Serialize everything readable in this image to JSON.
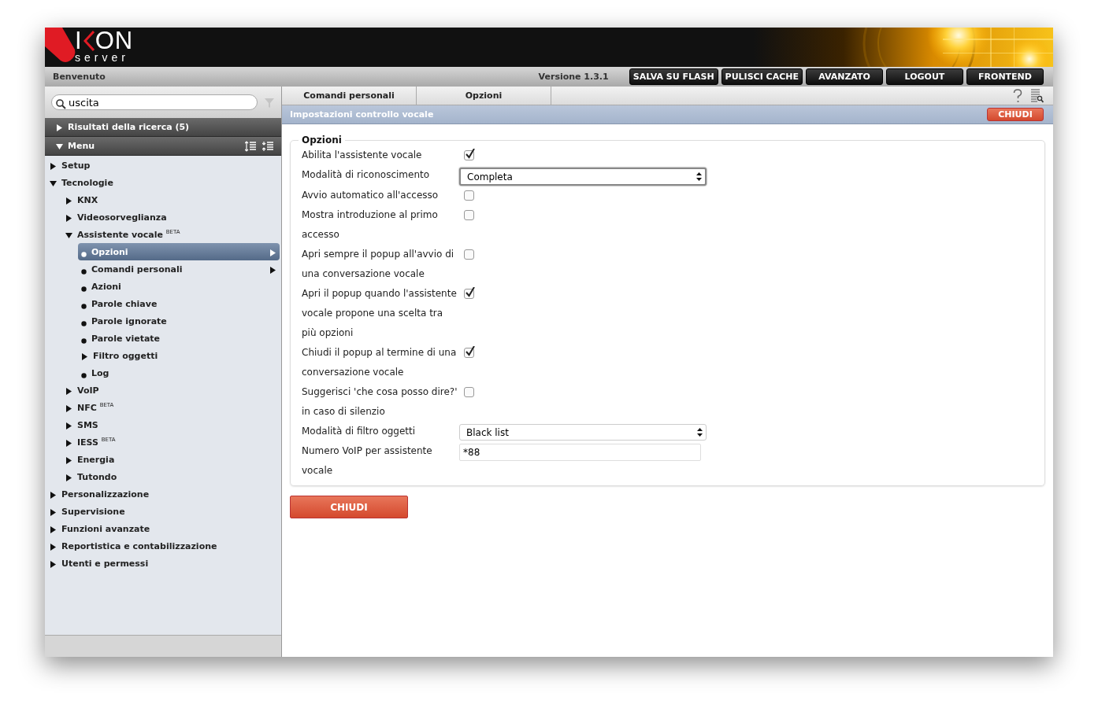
{
  "header": {
    "logo": {
      "lead": "I",
      "tail": "ON",
      "subtitle": "server"
    }
  },
  "topbar": {
    "welcome": "Benvenuto",
    "version": "Versione 1.3.1",
    "buttons": [
      "SALVA SU FLASH",
      "PULISCI CACHE",
      "AVANZATO",
      "LOGOUT",
      "FRONTEND"
    ]
  },
  "sidebar": {
    "search": {
      "value": "uscita"
    },
    "results": {
      "label": "Risultati della ricerca (5)",
      "expanded": false
    },
    "menu": {
      "label": "Menu",
      "expanded": true,
      "items": [
        {
          "label": "Setup",
          "kind": "branch",
          "expanded": false,
          "selected": false
        },
        {
          "label": "Tecnologie",
          "kind": "branch",
          "expanded": true,
          "selected": false,
          "children": [
            {
              "label": "KNX",
              "kind": "branch",
              "expanded": false,
              "selected": false
            },
            {
              "label": "Videosorveglianza",
              "kind": "branch",
              "expanded": false,
              "selected": false
            },
            {
              "label": "Assistente vocale $^{BETA}$",
              "kind": "branch",
              "expanded": true,
              "selected": false,
              "children": [
                {
                  "label": "Opzioni",
                  "kind": "leaf",
                  "selected": true,
                  "submenu": true
                },
                {
                  "label": "Comandi personali",
                  "kind": "leaf",
                  "selected": false,
                  "submenu": true
                },
                {
                  "label": "Azioni",
                  "kind": "leaf",
                  "selected": false,
                  "submenu": false
                },
                {
                  "label": "Parole chiave",
                  "kind": "leaf",
                  "selected": false,
                  "submenu": false
                },
                {
                  "label": "Parole ignorate",
                  "kind": "leaf",
                  "selected": false,
                  "submenu": false
                },
                {
                  "label": "Parole vietate",
                  "kind": "leaf",
                  "selected": false,
                  "submenu": false
                },
                {
                  "label": "Filtro oggetti",
                  "kind": "branch",
                  "expanded": false,
                  "selected": false
                },
                {
                  "label": "Log",
                  "kind": "leaf",
                  "selected": false,
                  "submenu": false
                }
              ]
            },
            {
              "label": "VoIP",
              "kind": "branch",
              "expanded": false,
              "selected": false
            },
            {
              "label": "NFC $^{BETA}$",
              "kind": "branch",
              "expanded": false,
              "selected": false
            },
            {
              "label": "SMS",
              "kind": "branch",
              "expanded": false,
              "selected": false
            },
            {
              "label": "IESS $^{BETA}$",
              "kind": "branch",
              "expanded": false,
              "selected": false
            },
            {
              "label": "Energia",
              "kind": "branch",
              "expanded": false,
              "selected": false
            },
            {
              "label": "Tutondo",
              "kind": "branch",
              "expanded": false,
              "selected": false
            }
          ]
        },
        {
          "label": "Personalizzazione",
          "kind": "branch",
          "expanded": false,
          "selected": false
        },
        {
          "label": "Supervisione",
          "kind": "branch",
          "expanded": false,
          "selected": false
        },
        {
          "label": "Funzioni avanzate",
          "kind": "branch",
          "expanded": false,
          "selected": false
        },
        {
          "label": "Reportistica e contabilizzazione",
          "kind": "branch",
          "expanded": false,
          "selected": false
        },
        {
          "label": "Utenti e permessi",
          "kind": "branch",
          "expanded": false,
          "selected": false
        }
      ]
    }
  },
  "main": {
    "tabs": [
      {
        "label": "Comandi personali",
        "selected": false
      },
      {
        "label": "Opzioni",
        "selected": false
      }
    ],
    "panel_title": "Impostazioni controllo vocale",
    "close_label": "CHIUDI",
    "fieldset": {
      "legend": "Opzioni",
      "rows": [
        {
          "kind": "checkbox",
          "label": "Abilita l'assistente vocale",
          "checked": true
        },
        {
          "kind": "select",
          "label": "Modalità di riconoscimento",
          "value": "Completa",
          "focused": true
        },
        {
          "kind": "checkbox",
          "label": "Avvio automatico all'accesso",
          "checked": false
        },
        {
          "kind": "checkbox",
          "label": "Mostra introduzione al primo accesso",
          "checked": false
        },
        {
          "kind": "checkbox",
          "label": "Apri sempre il popup all'avvio di una conversazione vocale",
          "checked": false
        },
        {
          "kind": "checkbox",
          "label": "Apri il popup quando l'assistente vocale propone una scelta tra più opzioni",
          "checked": true
        },
        {
          "kind": "checkbox",
          "label": "Chiudi il popup al termine di una conversazione vocale",
          "checked": true
        },
        {
          "kind": "checkbox",
          "label": "Suggerisci 'che cosa posso dire?' in caso di silenzio",
          "checked": false
        },
        {
          "kind": "select",
          "label": "Modalità di filtro oggetti",
          "value": "Black list",
          "focused": false
        },
        {
          "kind": "text",
          "label": "Numero VoIP per assistente vocale",
          "value": "*88"
        }
      ]
    },
    "button": "CHIUDI"
  }
}
